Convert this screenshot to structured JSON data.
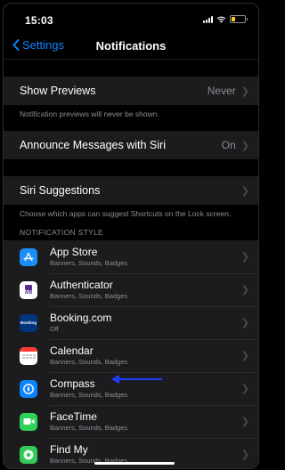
{
  "status_bar": {
    "time": "15:03"
  },
  "nav": {
    "back_label": "Settings",
    "title": "Notifications"
  },
  "general": {
    "show_previews": {
      "label": "Show Previews",
      "value": "Never"
    },
    "show_previews_footer": "Notification previews will never be shown.",
    "announce": {
      "label": "Announce Messages with Siri",
      "value": "On"
    },
    "siri": {
      "label": "Siri Suggestions"
    },
    "siri_footer": "Choose which apps can suggest Shortcuts on the Lock screen."
  },
  "section_header": "NOTIFICATION STYLE",
  "apps": [
    {
      "name": "App Store",
      "detail": "Banners, Sounds, Badges",
      "icon": "app-store-icon",
      "color": "#1c8ef9"
    },
    {
      "name": "Authenticator",
      "detail": "Banners, Sounds, Badges",
      "icon": "authenticator-icon",
      "color": "#ffffff",
      "icon_text": "AIB"
    },
    {
      "name": "Booking.com",
      "detail": "Off",
      "icon": "booking-icon",
      "color": "#003580",
      "icon_text": "Booking"
    },
    {
      "name": "Calendar",
      "detail": "Banners, Sounds, Badges",
      "icon": "calendar-icon",
      "color": "#ffffff"
    },
    {
      "name": "Compass",
      "detail": "Banners, Sounds, Badges",
      "icon": "compass-icon",
      "color": "#0a84ff"
    },
    {
      "name": "FaceTime",
      "detail": "Banners, Sounds, Badges",
      "icon": "facetime-icon",
      "color": "#30d158"
    },
    {
      "name": "Find My",
      "detail": "Banners, Sounds, Badges",
      "icon": "find-my-icon",
      "color": "#34c759"
    }
  ],
  "colors": {
    "accent": "#0a84ff",
    "annotation_arrow": "#1f3fff",
    "background": "#000000",
    "cell": "#1c1c1e"
  }
}
